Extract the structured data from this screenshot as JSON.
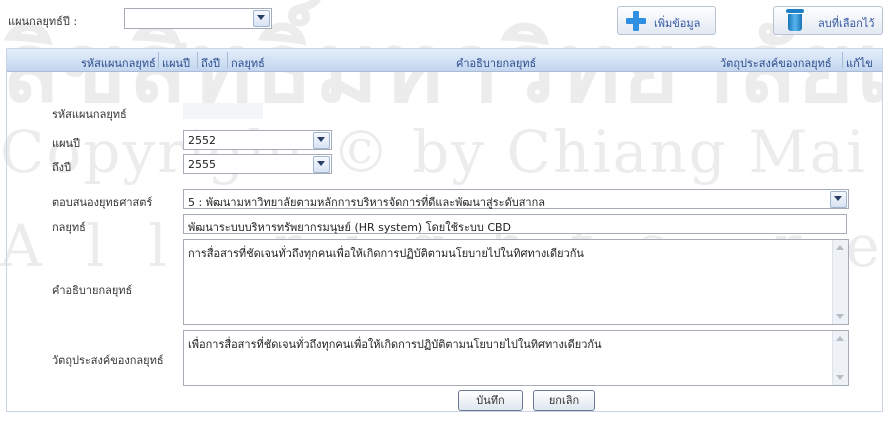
{
  "watermark": {
    "line1": "ลิขสิทธิ์มหาวิทยาลัยเชียงใหม่",
    "line2": "Copyright © by Chiang Mai University",
    "line3": "All rights reserved"
  },
  "toolbar": {
    "year_label": "แผนกลยุทธ์ปี :",
    "year_value": "",
    "add_label": "เพิ่มข้อมูล",
    "delete_label": "ลบที่เลือกไว้"
  },
  "grid": {
    "columns": [
      "รหัสแผนกลยุทธ์",
      "แผนปี",
      "ถึงปี",
      "กลยุทธ์",
      "คำอธิบายกลยุทธ์",
      "วัตถุประสงค์ของกลยุทธ์",
      "แก้ไข"
    ]
  },
  "form": {
    "code_label": "รหัสแผนกลยุทธ์",
    "code_value": "",
    "plan_year_label": "แผนปี",
    "plan_year_value": "2552",
    "to_year_label": "ถึงปี",
    "to_year_value": "2555",
    "strategy_response_label": "ตอบสนองยุทธศาสตร์",
    "strategy_response_value": "5 : พัฒนามหาวิทยาลัยตามหลักการบริหารจัดการที่ดีและพัฒนาสู่ระดับสากล",
    "strategy_label": "กลยุทธ์",
    "strategy_value": "พัฒนาระบบบริหารทรัพยากรมนุษย์ (HR system) โดยใช้ระบบ CBD",
    "description_label": "คำอธิบายกลยุทธ์",
    "description_value": "การสื่อสารที่ชัดเจนทั่วถึงทุกคนเพื่อให้เกิดการปฏิบัติตามนโยบายไปในทิศทางเดียวกัน",
    "objective_label": "วัตถุประสงค์ของกลยุทธ์",
    "objective_value": "เพื่อการสื่อสารที่ชัดเจนทั่วถึงทุกคนเพื่อให้เกิดการปฏิบัติตามนโยบายไปในทิศทางเดียวกัน",
    "save_label": "บันทึก",
    "cancel_label": "ยกเลิก"
  },
  "colors": {
    "header_text": "#2b4c8c",
    "add_icon": "#2f8fe0",
    "delete_icon": "#1f7fc4"
  }
}
